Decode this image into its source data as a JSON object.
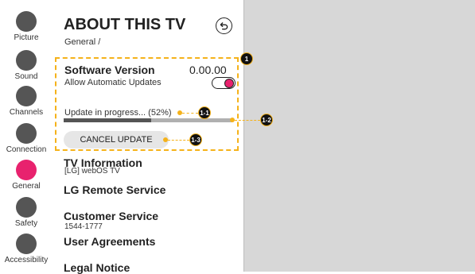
{
  "panel": {
    "title": "ABOUT THIS TV",
    "breadcrumb": "General /",
    "software": {
      "title": "Software Version",
      "version": "0.00.00",
      "auto_updates_label": "Allow Automatic Updates",
      "auto_updates_on": true
    },
    "update": {
      "progress_label": "Update in progress... (52%)",
      "progress_fraction": 0.52,
      "cancel_label": "CANCEL UPDATE"
    },
    "menu": {
      "tv_info": "TV Information",
      "tv_info_sub": "[LG] webOS TV",
      "remote": "LG Remote Service",
      "customer": "Customer Service",
      "customer_sub": "1544-1777",
      "agreements": "User Agreements",
      "legal": "Legal Notice"
    }
  },
  "categories": [
    {
      "label": "Picture",
      "active": false
    },
    {
      "label": "Sound",
      "active": false
    },
    {
      "label": "Channels",
      "active": false
    },
    {
      "label": "Connection",
      "active": false
    },
    {
      "label": "General",
      "active": true
    },
    {
      "label": "Safety",
      "active": false
    },
    {
      "label": "Accessibility",
      "active": false
    }
  ],
  "callouts": {
    "main": "1",
    "progress_label": "1-1",
    "progress_bar": "1-2",
    "cancel": "1-3"
  },
  "colors": {
    "accent": "#e8226e",
    "callout": "#f5b21a",
    "category_dot": "#555555"
  }
}
